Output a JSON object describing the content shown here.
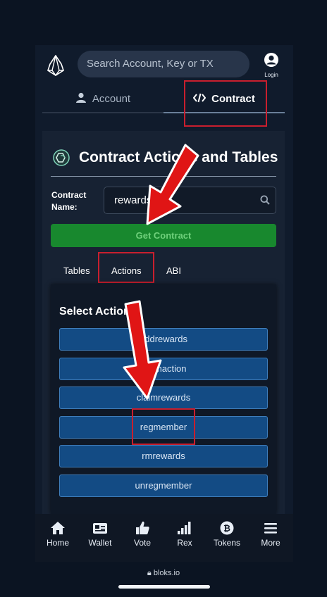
{
  "header": {
    "search_placeholder": "Search Account, Key or TX",
    "login_label": "Login"
  },
  "top_tabs": {
    "account": "Account",
    "contract": "Contract"
  },
  "card": {
    "title": "Contract Actions and Tables",
    "contract_name_label": "Contract Name:",
    "contract_name_value": "rewards",
    "get_contract_label": "Get Contract"
  },
  "sub_tabs": {
    "tables": "Tables",
    "actions": "Actions",
    "abi": "ABI"
  },
  "actions_panel": {
    "title": "Select Action",
    "actions": [
      "addrewards",
      "claimaction",
      "claimrewards",
      "regmember",
      "rmrewards",
      "unregmember"
    ]
  },
  "bottom_nav": {
    "home": "Home",
    "wallet": "Wallet",
    "vote": "Vote",
    "rex": "Rex",
    "tokens": "Tokens",
    "more": "More"
  },
  "url": "bloks.io",
  "colors": {
    "background": "#0b1422",
    "card": "#172233",
    "accent_green": "#18882e",
    "action_button": "#134b84",
    "highlight_red": "#c91f2e"
  }
}
